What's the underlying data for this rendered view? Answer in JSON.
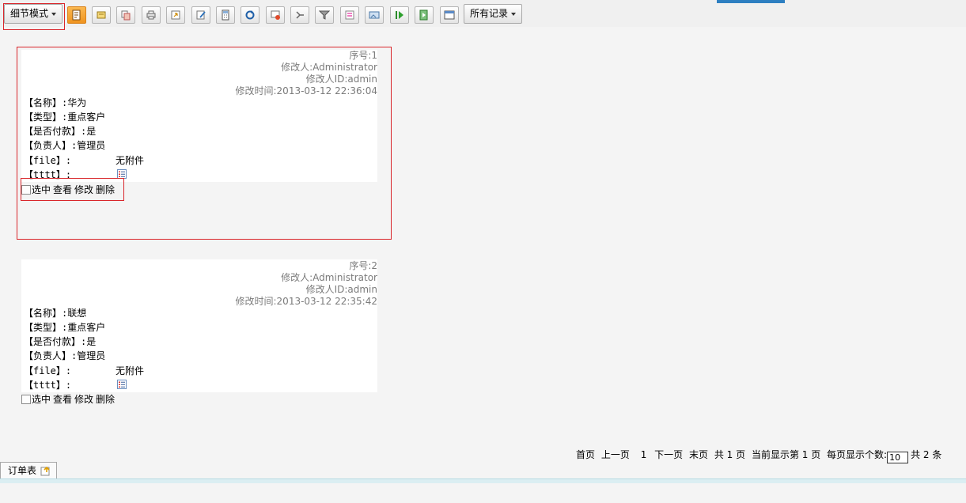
{
  "toolbar": {
    "mode_label": "细节模式",
    "filter_label": "所有记录",
    "icons": [
      "new-record-icon",
      "edit-icon",
      "copy-icon",
      "print-icon",
      "export-icon",
      "compose-icon",
      "calculator-icon",
      "refresh-icon",
      "delete-icon",
      "import-icon",
      "filter-icon",
      "report-icon",
      "image-icon",
      "play-icon",
      "bookmark-icon",
      "window-icon"
    ]
  },
  "records": [
    {
      "seq": "序号:1",
      "modifier": "修改人:Administrator",
      "modifier_id": "修改人ID:admin",
      "modified_time": "修改时间:2013-03-12 22:36:04",
      "fields": [
        {
          "label": "【名称】:",
          "value": "华为"
        },
        {
          "label": "【类型】:",
          "value": "重点客户"
        },
        {
          "label": "【是否付款】:",
          "value": "是"
        },
        {
          "label": "【负责人】:",
          "value": "管理员"
        },
        {
          "label": "【file】:",
          "value": "无附件"
        },
        {
          "label": "【tttt】:",
          "value": ""
        }
      ]
    },
    {
      "seq": "序号:2",
      "modifier": "修改人:Administrator",
      "modifier_id": "修改人ID:admin",
      "modified_time": "修改时间:2013-03-12 22:35:42",
      "fields": [
        {
          "label": "【名称】:",
          "value": "联想"
        },
        {
          "label": "【类型】:",
          "value": "重点客户"
        },
        {
          "label": "【是否付款】:",
          "value": "是"
        },
        {
          "label": "【负责人】:",
          "value": "管理员"
        },
        {
          "label": "【file】:",
          "value": "无附件"
        },
        {
          "label": "【tttt】:",
          "value": ""
        }
      ]
    }
  ],
  "actions": {
    "select": "选中",
    "view": "查看",
    "edit": "修改",
    "delete": "删除"
  },
  "pager": {
    "first": "首页",
    "prev": "上一页",
    "current_page": "1",
    "next": "下一页",
    "last": "末页",
    "total_pages": "共 1 页",
    "showing": "当前显示第 1 页",
    "per_page_label": "每页显示个数:",
    "per_page_value": "10",
    "total_records": "共 2 条"
  },
  "bottom_tab": {
    "label": "订单表"
  },
  "colors": {
    "highlight": "#d9262b",
    "accent": "#2d7fc1",
    "active_icon": "#ef9420"
  }
}
